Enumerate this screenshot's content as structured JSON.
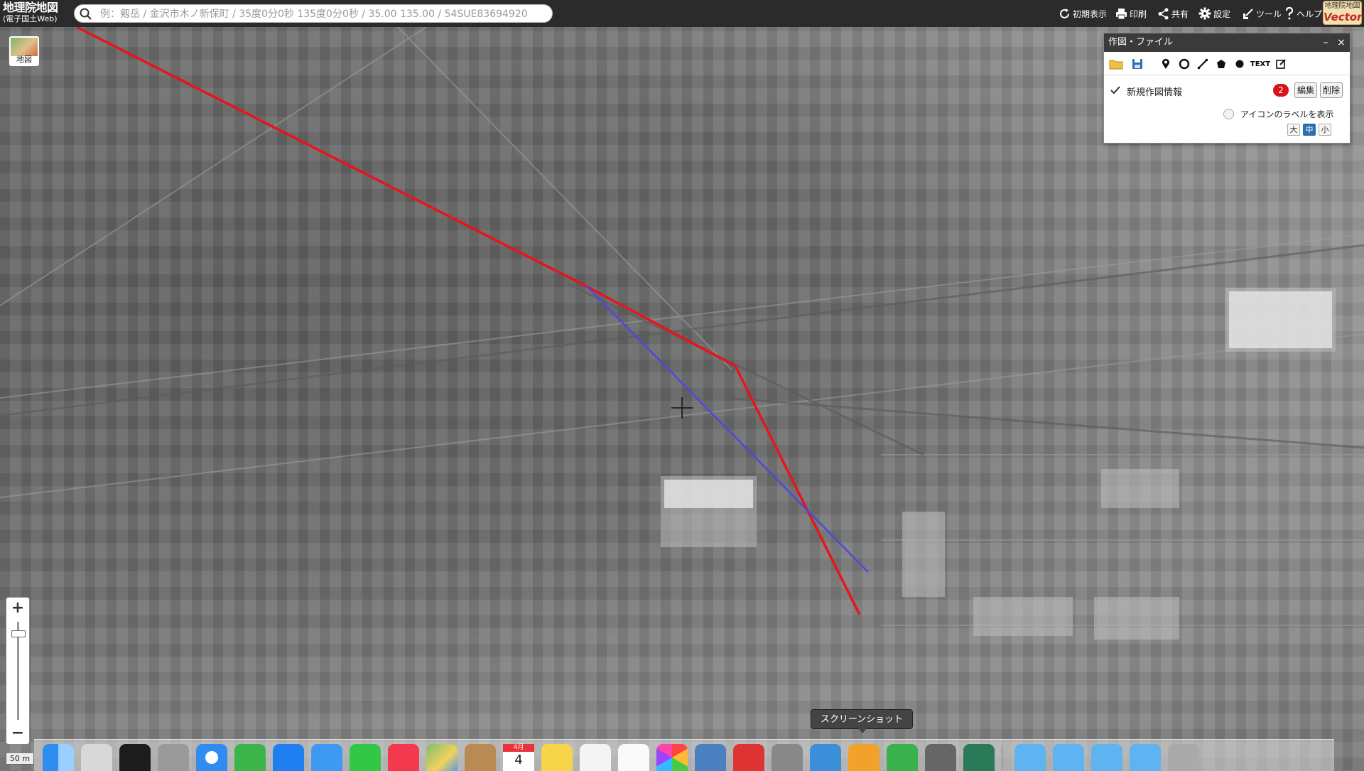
{
  "header": {
    "logo_main": "地理院地図",
    "logo_sub": "(電子国土Web)",
    "search_placeholder": "例：剱岳 / 金沢市木ノ新保町 / 35度0分0秒 135度0分0秒 / 35.00 135.00 / 54SUE83694920",
    "buttons": [
      {
        "label": "初期表示",
        "icon": "refresh-icon"
      },
      {
        "label": "印刷",
        "icon": "printer-icon"
      },
      {
        "label": "共有",
        "icon": "share-icon"
      },
      {
        "label": "設定",
        "icon": "gear-icon"
      },
      {
        "label": "ツール",
        "icon": "tool-icon"
      },
      {
        "label": "ヘルプ",
        "icon": "help-icon"
      }
    ],
    "vector_line1": "地理院地図",
    "vector_line2": "Vector"
  },
  "layer_button": {
    "label": "地図"
  },
  "panel": {
    "title": "作図・ファイル",
    "minimize": "–",
    "close": "×",
    "text_tool": "TEXT",
    "item_label": "新規作図情報",
    "item_count": "2",
    "edit_label": "編集",
    "delete_label": "削除",
    "show_label_text": "アイコンのラベルを表示",
    "size_large": "大",
    "size_medium": "中",
    "size_small": "小",
    "size_selected": "中"
  },
  "zoom": {
    "in": "+",
    "out": "−"
  },
  "scale": {
    "label": "50 m"
  },
  "tooltip": {
    "text": "スクリーンショット"
  },
  "calendar": {
    "month": "4月",
    "day": "4"
  },
  "colors": {
    "red_line": "#e8141c",
    "blue_line": "#4a4ae0",
    "count_badge": "#d8111b",
    "active_size": "#2b6fb0"
  }
}
